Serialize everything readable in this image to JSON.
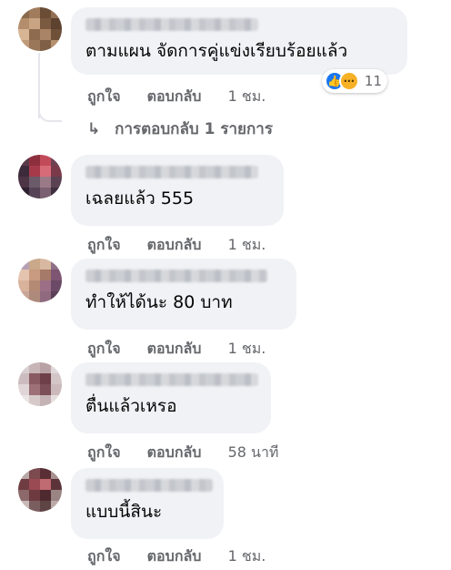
{
  "comments": [
    {
      "text": "ตามแผน จัดการคู่แข่งเรียบร้อยแล้ว",
      "like": "ถูกใจ",
      "reply": "ตอบกลับ",
      "time": "1 ชม.",
      "reactions": {
        "icons": [
          "like-icon",
          "haha-icon"
        ],
        "count": "11"
      }
    },
    {
      "text": "เฉลยแล้ว 555",
      "like": "ถูกใจ",
      "reply": "ตอบกลับ",
      "time": "1 ชม."
    },
    {
      "text": "ทำให้ได้นะ 80 บาท",
      "like": "ถูกใจ",
      "reply": "ตอบกลับ",
      "time": "1 ชม."
    },
    {
      "text": "ตื่นแล้วเหรอ",
      "like": "ถูกใจ",
      "reply": "ตอบกลับ",
      "time": "58 นาที"
    },
    {
      "text": "แบบนี้สินะ",
      "like": "ถูกใจ",
      "reply": "ตอบกลับ",
      "time": "1 ชม."
    }
  ],
  "view_replies": {
    "arrow": "↳",
    "label": "การตอบกลับ 1 รายการ"
  },
  "colors": {
    "bubble": "#f0f2f5",
    "meta": "#65676b",
    "like_blue": "#1877f2",
    "haha_yellow": "#f7b125"
  }
}
